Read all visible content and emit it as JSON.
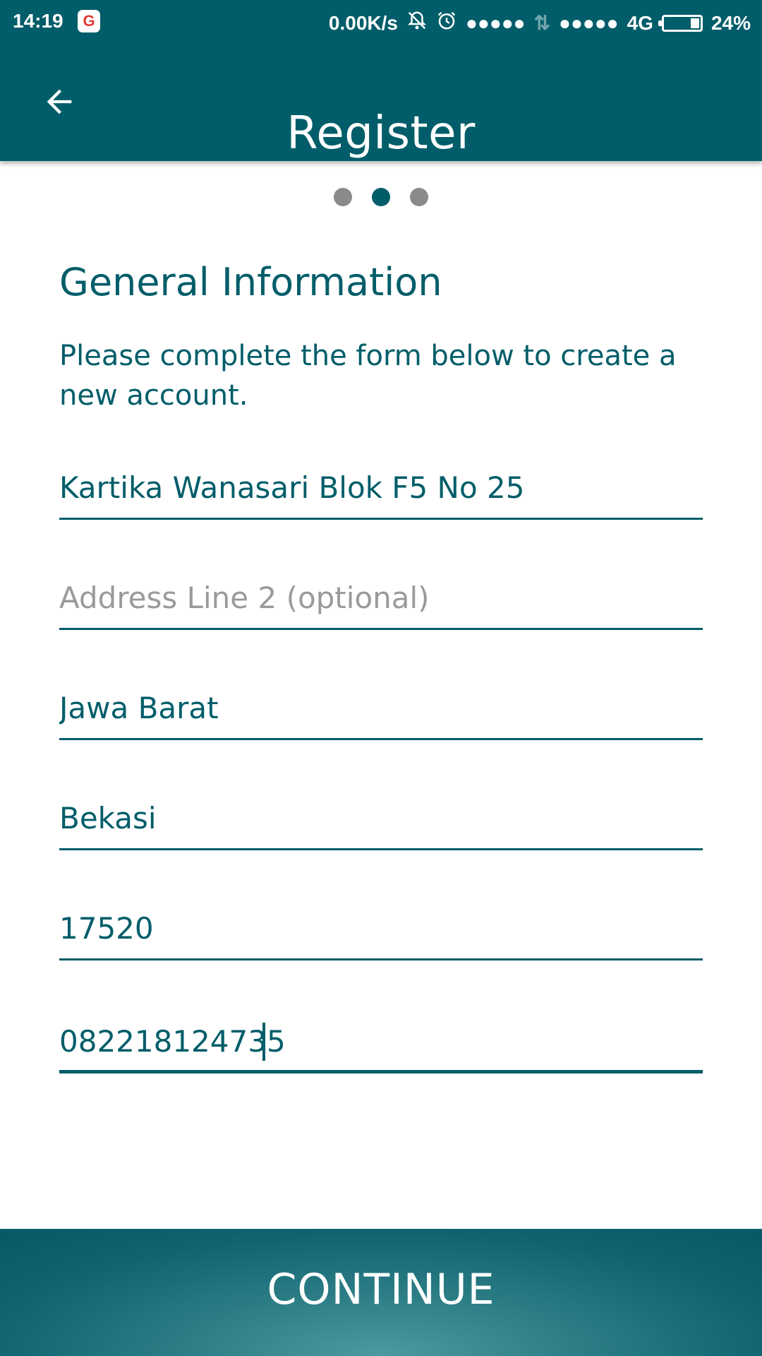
{
  "status_bar": {
    "time": "14:19",
    "g_badge": "G",
    "network_speed": "0.00K/s",
    "signal_1": "●●●●●",
    "data_arrows": "⇅",
    "signal_2": "●●●●●",
    "network_type": "4G",
    "battery_percent": "24%",
    "battery_level": 0.24
  },
  "app_bar": {
    "title": "Register"
  },
  "pager": {
    "pages": 3,
    "active_index": 1
  },
  "section": {
    "title": "General Information",
    "description": "Please complete the form below to create a new account."
  },
  "form": {
    "address_line_1": {
      "value": "Kartika Wanasari Blok F5 No 25",
      "placeholder": ""
    },
    "address_line_2": {
      "value": "",
      "placeholder": "Address Line 2 (optional)"
    },
    "province": {
      "value": "Jawa Barat",
      "placeholder": ""
    },
    "city": {
      "value": "Bekasi",
      "placeholder": ""
    },
    "postal_code": {
      "value": "17520",
      "placeholder": ""
    },
    "phone": {
      "value": "082218124735",
      "placeholder": ""
    }
  },
  "continue_label": "CONTINUE",
  "colors": {
    "primary": "#005d69",
    "placeholder": "#9a9a9a",
    "dot_inactive": "#8a8a8a"
  },
  "icons": {
    "back": "arrow-left-icon",
    "mute": "bell-off-icon",
    "alarm": "alarm-clock-icon",
    "battery": "battery-icon"
  }
}
